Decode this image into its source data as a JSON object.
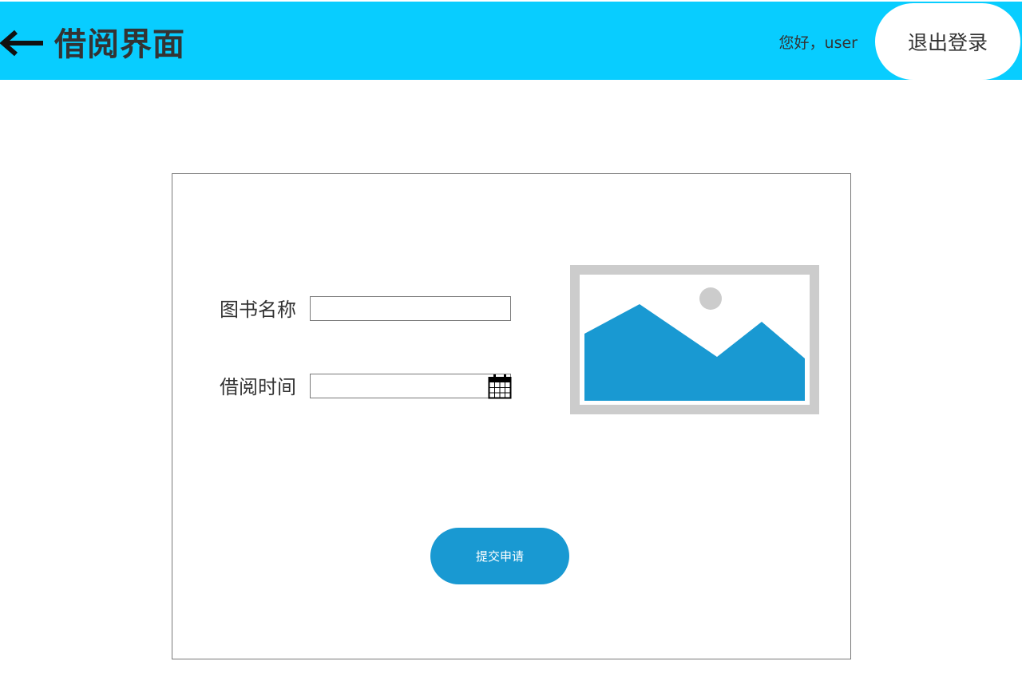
{
  "colors": {
    "header_bg": "#08cdff",
    "accent": "#1999d2",
    "image_frame": "#cccccc"
  },
  "header": {
    "back_icon": "arrow-left-icon",
    "title": "借阅界面",
    "greeting": "您好，user",
    "logout_label": "退出登录"
  },
  "form": {
    "book_name_label": "图书名称",
    "book_name_value": "",
    "borrow_time_label": "借阅时间",
    "borrow_time_value": "",
    "calendar_icon": "calendar-icon",
    "image_icon": "image-placeholder-icon",
    "submit_label": "提交申请"
  }
}
